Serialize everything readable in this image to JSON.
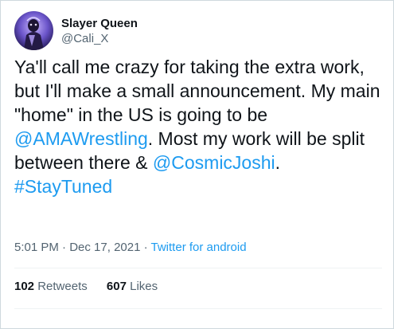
{
  "user": {
    "display_name": "Slayer Queen",
    "handle": "@Cali_X"
  },
  "tweet": {
    "text_1": "Ya'll call me crazy for taking the extra work, but I'll make a small announcement. My main \"home\" in the US is going to be ",
    "mention_1": "@AMAWrestling",
    "text_2": ". Most my work will be split between there & ",
    "mention_2": "@CosmicJoshi",
    "text_3": ".",
    "hashtag": "#StayTuned"
  },
  "meta": {
    "time": "5:01 PM",
    "dot_1": " · ",
    "date": "Dec 17, 2021",
    "dot_2": " · ",
    "source": "Twitter for android"
  },
  "stats": {
    "retweets_count": "102",
    "retweets_label": "Retweets",
    "likes_count": "607",
    "likes_label": "Likes"
  },
  "colors": {
    "link": "#1d9bf0",
    "secondary_text": "#536471",
    "primary_text": "#0f1419",
    "border": "#cfd9de"
  }
}
